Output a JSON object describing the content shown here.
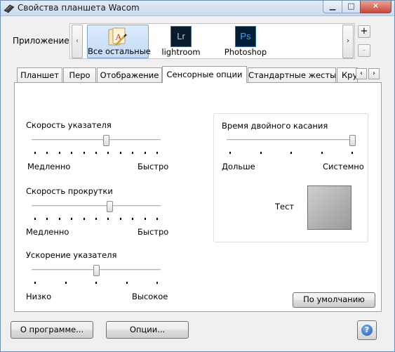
{
  "window": {
    "title": "Свойства планшета Wacom"
  },
  "app_bar": {
    "label": "Приложение:",
    "apps": [
      {
        "name": "Все остальные",
        "icon": "all-apps-icon",
        "selected": true
      },
      {
        "name": "lightroom",
        "icon": "lightroom-icon",
        "badge": "Lr",
        "selected": false
      },
      {
        "name": "Photoshop",
        "icon": "photoshop-icon",
        "badge": "Ps",
        "selected": false
      }
    ],
    "add_label": "+",
    "remove_label": "-"
  },
  "tabs": [
    "Планшет",
    "Перо",
    "Отображение",
    "Сенсорные опции",
    "Стандартные жесты",
    "Кру"
  ],
  "active_tab": "Сенсорные опции",
  "pointer_speed": {
    "label": "Скорость указателя",
    "min_label": "Медленно",
    "max_label": "Быстро",
    "value": 0.58
  },
  "scroll_speed": {
    "label": "Скорость прокрутки",
    "min_label": "Медленно",
    "max_label": "Быстро",
    "value": 0.61
  },
  "pointer_accel": {
    "label": "Ускорение указателя",
    "min_label": "Низко",
    "max_label": "Высокое",
    "value": 0.5
  },
  "double_tap": {
    "label": "Время двойного касания",
    "min_label": "Дольше",
    "max_label": "Системно",
    "value": 1.0,
    "test_label": "Тест"
  },
  "buttons": {
    "defaults": "По умолчанию",
    "about": "О программе...",
    "options": "Опции...",
    "help": "?"
  },
  "colors": {
    "lr_bg": "#0a1b2c",
    "lr_fg": "#a8c8e8",
    "ps_bg": "#001d34",
    "ps_fg": "#31a8ff"
  }
}
